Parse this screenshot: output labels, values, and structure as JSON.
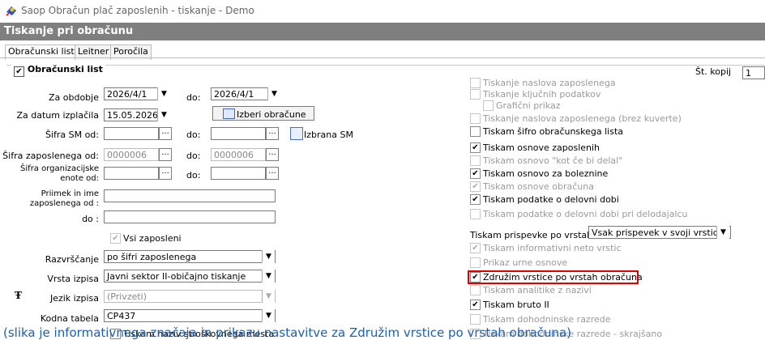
{
  "window": {
    "title": "Saop Obračun plač zaposlenih - tiskanje - Demo"
  },
  "header": {
    "title": "Tiskanje pri obračunu"
  },
  "tabs": [
    "Obračunski list",
    "Leitner",
    "Poročila"
  ],
  "group": {
    "title": "Obračunski list",
    "checked": true
  },
  "st_kopij": {
    "label": "Št. kopij",
    "value": "1"
  },
  "left": {
    "za_obdobje": {
      "label": "Za obdobje",
      "from": "2026/4/1",
      "do_label": "do:",
      "to": "2026/4/1"
    },
    "za_datum": {
      "label": "Za datum izplačila",
      "value": "15.05.2026"
    },
    "izberi_btn": "Izberi obračune ...",
    "sifra_sm": {
      "label": "Šifra SM od:",
      "do_label": "do:",
      "from": "",
      "to": ""
    },
    "izbrana_sm": "Izbrana SM",
    "sifra_zap": {
      "label": "Šifra zaposlenega od:",
      "from": "0000006",
      "do_label": "do:",
      "to": "0000006"
    },
    "sifra_org": {
      "label1": "Šifra organizacijske",
      "label2": "enote od:",
      "do_label": "do:"
    },
    "priimek": {
      "label1": "Priimek in ime",
      "label2": "zaposlenega od :",
      "do_label": "do :"
    },
    "vsi_zaposleni": "Vsi zaposleni",
    "razvrscanje": {
      "label": "Razvrščanje",
      "value": "po šifri zaposlenega"
    },
    "vrsta_izpisa": {
      "label": "Vrsta izpisa",
      "value": "Javni sektor II-običajno tiskanje"
    },
    "jezik_izpisa": {
      "label": "Jezik izpisa",
      "value": "(Privzeti)"
    },
    "kodna_tabela": {
      "label": "Kodna tabela",
      "value": "CP437"
    },
    "naziv_sm": "Tiskam naziv stroškovnega mesta"
  },
  "right": {
    "items": [
      {
        "label": "Tiskanje naslova zaposlenega",
        "checked": false,
        "enabled": false
      },
      {
        "label": "Tiskanje ključnih podatkov",
        "checked": false,
        "enabled": false
      },
      {
        "label": "Grafični prikaz",
        "checked": false,
        "enabled": false
      },
      {
        "label": "Tiskanje naslova zaposlenega (brez kuverte)",
        "checked": false,
        "enabled": false
      },
      {
        "label": "Tiskam šifro obračunskega lista",
        "checked": false,
        "enabled": true
      },
      {
        "label": "Tiskam osnove zaposlenih",
        "checked": true,
        "enabled": true
      },
      {
        "label": "Tiskam osnovo \"kot če bi delal\"",
        "checked": false,
        "enabled": false
      },
      {
        "label": "Tiskam osnovo za boleznine",
        "checked": true,
        "enabled": true
      },
      {
        "label": "Tiskam osnove obračuna",
        "checked": true,
        "enabled": false
      },
      {
        "label": "Tiskam podatke o delovni dobi",
        "checked": true,
        "enabled": true
      },
      {
        "label": "Tiskam podatke o delovni dobi pri delodajalcu",
        "checked": false,
        "enabled": false
      }
    ],
    "prispevke": {
      "label": "Tiskam prispevke po vrstah",
      "value": "Vsak prispevek v svoji vrstici"
    },
    "items2": [
      {
        "label": "Tiskam informativni neto vrstic",
        "checked": true,
        "enabled": false
      },
      {
        "label": "Prikaz urne osnove",
        "checked": false,
        "enabled": false
      },
      {
        "label": "Združim vrstice po vrstah obračuna",
        "checked": true,
        "enabled": true
      },
      {
        "label": "Tiskam analitike z nazivi",
        "checked": false,
        "enabled": false
      },
      {
        "label": "Tiskam bruto II",
        "checked": true,
        "enabled": true
      },
      {
        "label": "Tiskam dohodninske razrede",
        "checked": false,
        "enabled": false
      },
      {
        "label": "Tiskam dohodninske razrede - skrajšano",
        "checked": false,
        "enabled": false
      }
    ]
  },
  "caption": "(slika je informativnega značaja in prikazu nastavitve za Združim vrstice po vrstah obračuna)"
}
